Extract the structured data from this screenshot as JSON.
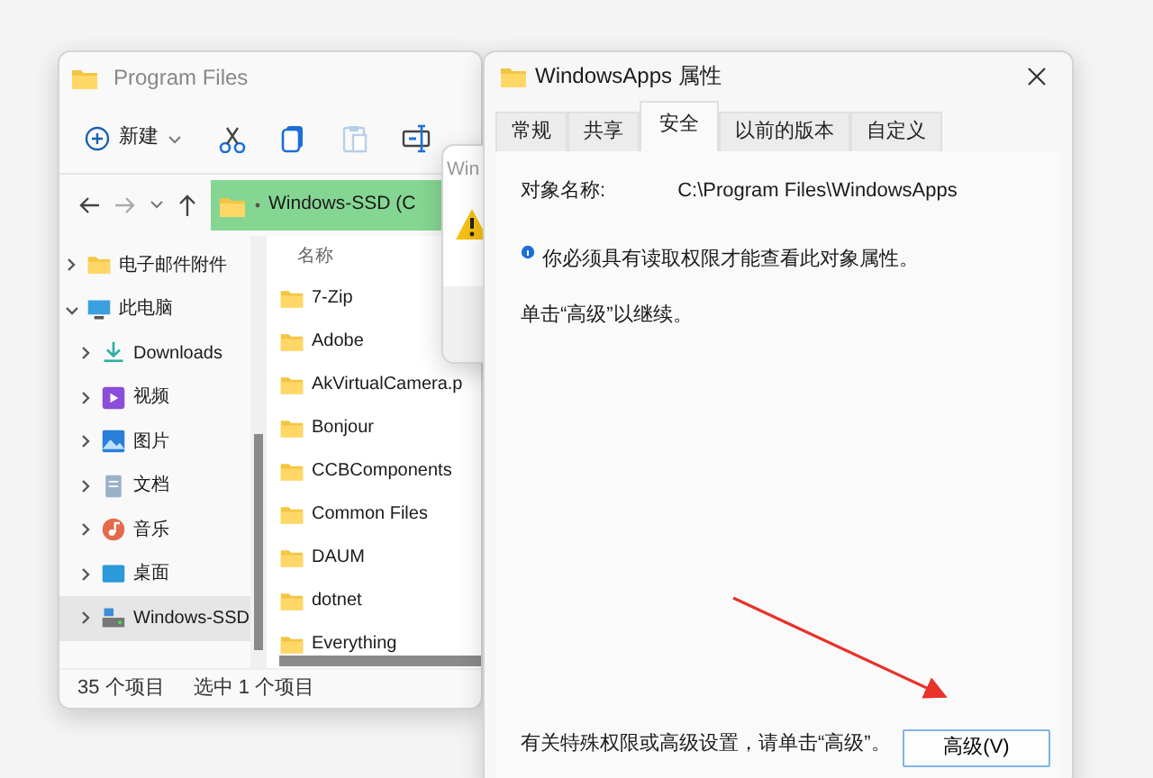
{
  "explorer": {
    "title": "Program Files",
    "new_button": "新建",
    "toolbar_buttons": [
      {
        "kind": "cut",
        "disabled": false
      },
      {
        "kind": "copy",
        "disabled": false
      },
      {
        "kind": "paste",
        "disabled": true
      },
      {
        "kind": "rename",
        "disabled": false
      }
    ],
    "address": "Windows-SSD (C",
    "nav_tree": [
      {
        "label": "电子邮件附件",
        "kind": "folder",
        "expanded": false,
        "selected": false
      },
      {
        "label": "此电脑",
        "kind": "pc",
        "expanded": true,
        "selected": false,
        "children": [
          {
            "label": "Downloads",
            "kind": "downloads",
            "expanded": false,
            "selected": false
          },
          {
            "label": "视频",
            "kind": "videos",
            "expanded": false,
            "selected": false
          },
          {
            "label": "图片",
            "kind": "pictures",
            "expanded": false,
            "selected": false
          },
          {
            "label": "文档",
            "kind": "documents",
            "expanded": false,
            "selected": false
          },
          {
            "label": "音乐",
            "kind": "music",
            "expanded": false,
            "selected": false
          },
          {
            "label": "桌面",
            "kind": "desktop",
            "expanded": false,
            "selected": false
          },
          {
            "label": "Windows-SSD",
            "kind": "drive",
            "expanded": false,
            "selected": true
          }
        ]
      }
    ],
    "column_header": "名称",
    "files": [
      "7-Zip",
      "Adobe",
      "AkVirtualCamera.p",
      "Bonjour",
      "CCBComponents",
      "Common Files",
      "DAUM",
      "dotnet",
      "Everything"
    ],
    "status_bar": {
      "item_count": "35 个项目",
      "selection": "选中 1 个项目"
    }
  },
  "warning_dialog": {
    "title": "Win"
  },
  "properties_dialog": {
    "title": "WindowsApps 属性",
    "tabs": [
      {
        "label": "常规",
        "selected": false
      },
      {
        "label": "共享",
        "selected": false
      },
      {
        "label": "安全",
        "selected": true
      },
      {
        "label": "以前的版本",
        "selected": false
      },
      {
        "label": "自定义",
        "selected": false
      }
    ],
    "object_name_label": "对象名称:",
    "object_name": "C:\\Program Files\\WindowsApps",
    "notice": "你必须具有读取权限才能查看此对象属性。",
    "hint": "单击“高级”以继续。",
    "advanced_text": "有关特殊权限或高级设置，请单击“高级”。",
    "advanced_button": "高级(V)"
  }
}
